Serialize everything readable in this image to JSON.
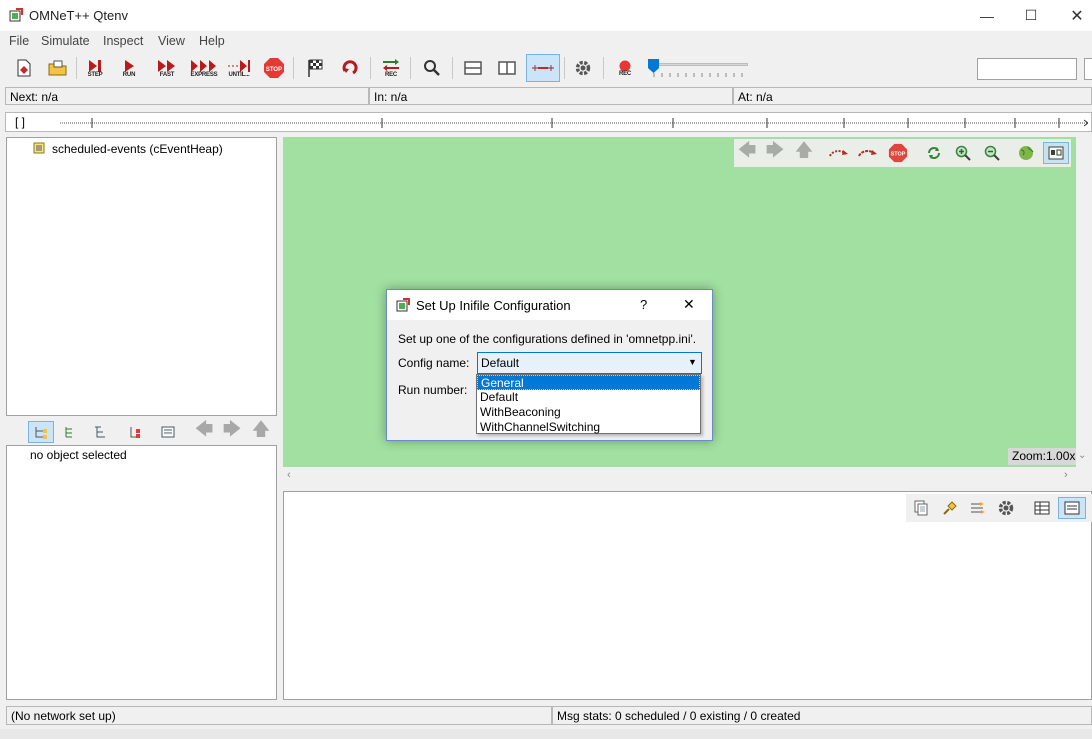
{
  "window": {
    "title": "OMNeT++ Qtenv"
  },
  "menu": [
    "File",
    "Simulate",
    "Inspect",
    "View",
    "Help"
  ],
  "toolbar": {
    "step": "STEP",
    "run": "RUN",
    "fast": "FAST",
    "express": "EXPRESS",
    "until": "UNTIL...",
    "stop": "STOP",
    "rec": "REC",
    "record": "REC",
    "search_value": ""
  },
  "status": {
    "next": "Next: n/a",
    "in": "In: n/a",
    "at": "At: n/a"
  },
  "timeline": {
    "bracket": "[  ]"
  },
  "object_tree": {
    "items": [
      "scheduled-events (cEventHeap)"
    ]
  },
  "inspector": {
    "empty_text": "no object selected"
  },
  "canvas": {
    "zoom": "Zoom:1.00x",
    "stop": "STOP",
    "background": "#a1e0a1"
  },
  "dialog": {
    "title": "Set Up Inifile Configuration",
    "help": "?",
    "close": "✕",
    "description": "Set up one of the configurations defined in 'omnetpp.ini'.",
    "config_label": "Config name:",
    "config_value": "Default",
    "run_label": "Run number:",
    "options": [
      "General",
      "Default",
      "WithBeaconing",
      "WithChannelSwitching"
    ],
    "selected_option": "General"
  },
  "statusbar": {
    "network": "(No network set up)",
    "msgstats": "Msg stats: 0 scheduled / 0 existing / 0 created"
  }
}
